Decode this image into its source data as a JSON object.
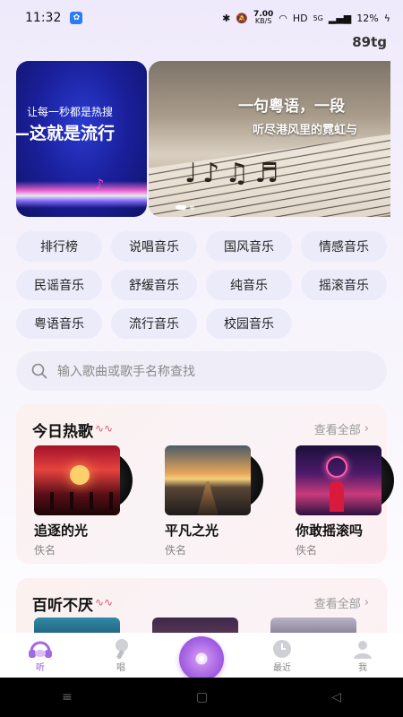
{
  "status_bar": {
    "time": "11:32",
    "app_icon": "app-notification-icon",
    "net_speed_value": "7.00",
    "net_speed_unit": "KB/S",
    "hd": "HD",
    "signal": "5G",
    "battery": "12%"
  },
  "top_right_label": "89tg",
  "banner": {
    "left_line1": "让每一秒都是热搜",
    "left_line2": "—这就是流行",
    "right_line1": "一句粤语，一段",
    "right_line2": "听尽港风里的霓虹与"
  },
  "categories": [
    "排行榜",
    "说唱音乐",
    "国风音乐",
    "情感音乐",
    "民谣音乐",
    "舒缓音乐",
    "纯音乐",
    "摇滚音乐",
    "粤语音乐",
    "流行音乐",
    "校园音乐"
  ],
  "search": {
    "placeholder": "输入歌曲或歌手名称查找"
  },
  "hot_today": {
    "title": "今日热歌",
    "more": "查看全部",
    "songs": [
      {
        "name": "追逐的光",
        "artist": "佚名"
      },
      {
        "name": "平凡之光",
        "artist": "佚名"
      },
      {
        "name": "你敢摇滚吗",
        "artist": "佚名"
      }
    ]
  },
  "favorites": {
    "title": "百听不厌",
    "more": "查看全部"
  },
  "bottom_nav": {
    "listen": "听",
    "sing": "唱",
    "recent": "最近",
    "me": "我"
  },
  "colors": {
    "accent": "#8a5bd9",
    "wave": "#e5526b",
    "chip_bg": "#ecebfa"
  }
}
